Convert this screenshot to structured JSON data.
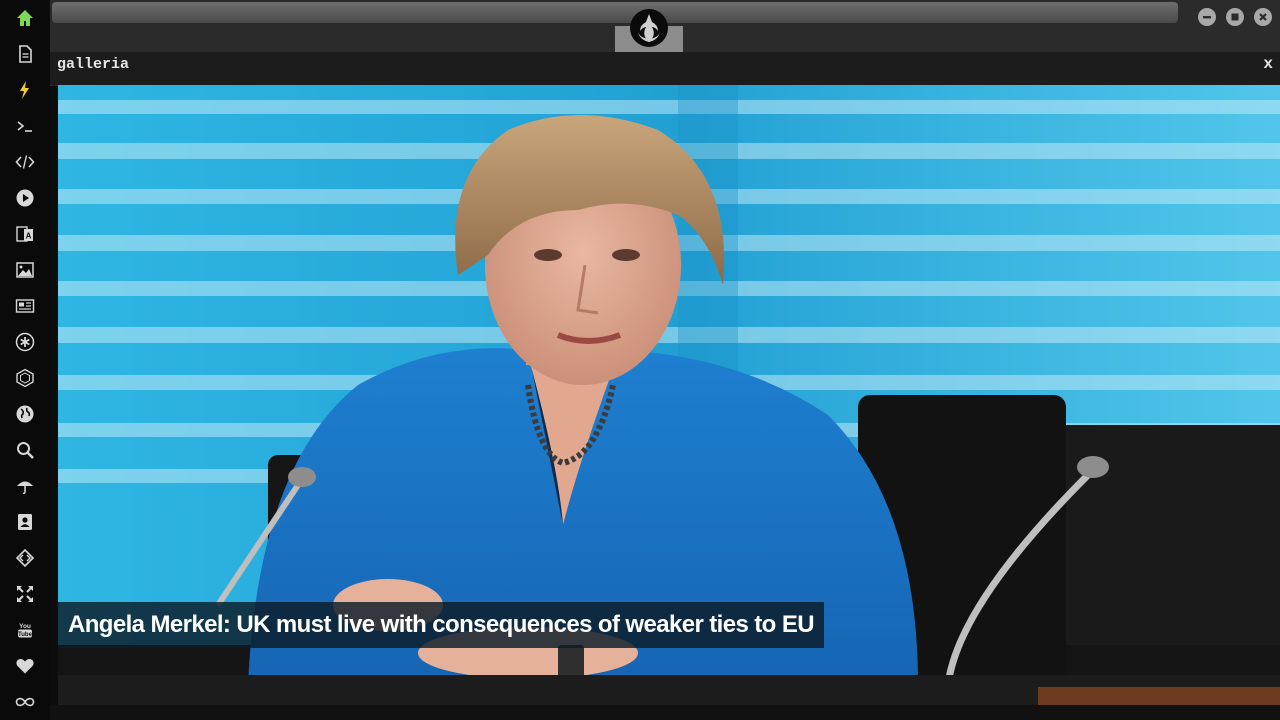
{
  "sidebar": {
    "items": [
      {
        "name": "home-icon",
        "active": true
      },
      {
        "name": "document-icon"
      },
      {
        "name": "lightning-icon"
      },
      {
        "name": "terminal-icon"
      },
      {
        "name": "code-icon"
      },
      {
        "name": "play-icon"
      },
      {
        "name": "translate-icon"
      },
      {
        "name": "image-icon"
      },
      {
        "name": "news-icon"
      },
      {
        "name": "asterisk-icon"
      },
      {
        "name": "hexagon-icon"
      },
      {
        "name": "globe-icon"
      },
      {
        "name": "search-icon"
      },
      {
        "name": "umbrella-icon"
      },
      {
        "name": "contacts-icon"
      },
      {
        "name": "code-diamond-icon"
      },
      {
        "name": "expand-icon"
      },
      {
        "name": "youtube-icon"
      },
      {
        "name": "heart-icon"
      },
      {
        "name": "infinity-icon"
      }
    ],
    "accent_color": "#7ed957",
    "lightning_color": "#f2d028"
  },
  "window": {
    "logo": "rebel-alliance-icon",
    "controls": [
      "minimize-icon",
      "maximize-icon",
      "close-icon"
    ]
  },
  "panel": {
    "title": "galleria",
    "close_label": "x"
  },
  "gallery": {
    "caption": "Angela Merkel: UK must live with consequences of weaker ties to EU"
  }
}
